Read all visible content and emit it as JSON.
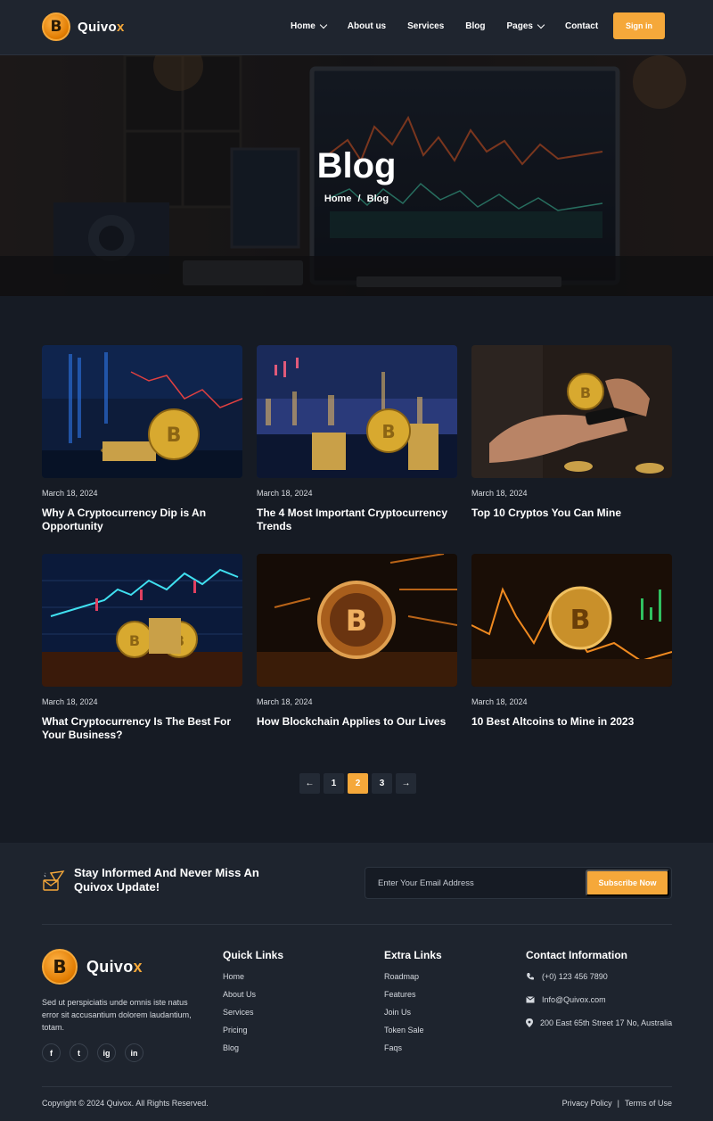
{
  "brand": {
    "name_main": "Quivo",
    "name_accent": "x",
    "logo_glyph": "B",
    "accent_color": "#f5a83a"
  },
  "nav": {
    "items": [
      {
        "label": "Home",
        "dropdown": true
      },
      {
        "label": "About us",
        "dropdown": false
      },
      {
        "label": "Services",
        "dropdown": false
      },
      {
        "label": "Blog",
        "dropdown": false
      },
      {
        "label": "Pages",
        "dropdown": true
      },
      {
        "label": "Contact",
        "dropdown": false
      }
    ],
    "signin_label": "Sign in"
  },
  "hero": {
    "title": "Blog",
    "breadcrumb_home": "Home",
    "breadcrumb_sep": "/",
    "breadcrumb_current": "Blog"
  },
  "posts": [
    {
      "date": "March 18, 2024",
      "title": "Why A Cryptocurrency Dip is An Opportunity"
    },
    {
      "date": "March 18, 2024",
      "title": "The 4 Most Important Cryptocurrency Trends"
    },
    {
      "date": "March 18, 2024",
      "title": "Top 10 Cryptos You Can Mine"
    },
    {
      "date": "March 18, 2024",
      "title": "What Cryptocurrency Is The Best For Your Business?"
    },
    {
      "date": "March 18, 2024",
      "title": "How Blockchain Applies to Our Lives"
    },
    {
      "date": "March 18, 2024",
      "title": "10 Best Altcoins to Mine in 2023"
    }
  ],
  "pagination": {
    "prev": "←",
    "pages": [
      "1",
      "2",
      "3"
    ],
    "current": "2",
    "next": "→"
  },
  "newsletter": {
    "text": "Stay Informed And Never Miss An Quivox Update!",
    "placeholder": "Enter Your Email Address",
    "button": "Subscribe Now"
  },
  "footer": {
    "about": "Sed ut perspiciatis unde omnis iste natus error sit accusantium dolorem laudantium, totam.",
    "socials": [
      "f",
      "t",
      "ig",
      "in"
    ],
    "quick_links": {
      "title": "Quick Links",
      "items": [
        "Home",
        "About Us",
        "Services",
        "Pricing",
        "Blog"
      ]
    },
    "extra_links": {
      "title": "Extra Links",
      "items": [
        "Roadmap",
        "Features",
        "Join Us",
        "Token Sale",
        "Faqs"
      ]
    },
    "contact": {
      "title": "Contact Information",
      "phone": "(+0) 123 456 7890",
      "email": "Info@Quivox.com",
      "address": "200 East 65th Street 17 No, Australia"
    },
    "copyright": "Copyright © 2024 Quivox. All Rights Reserved.",
    "privacy": "Privacy Policy",
    "legal_sep": "|",
    "terms": "Terms of Use"
  }
}
